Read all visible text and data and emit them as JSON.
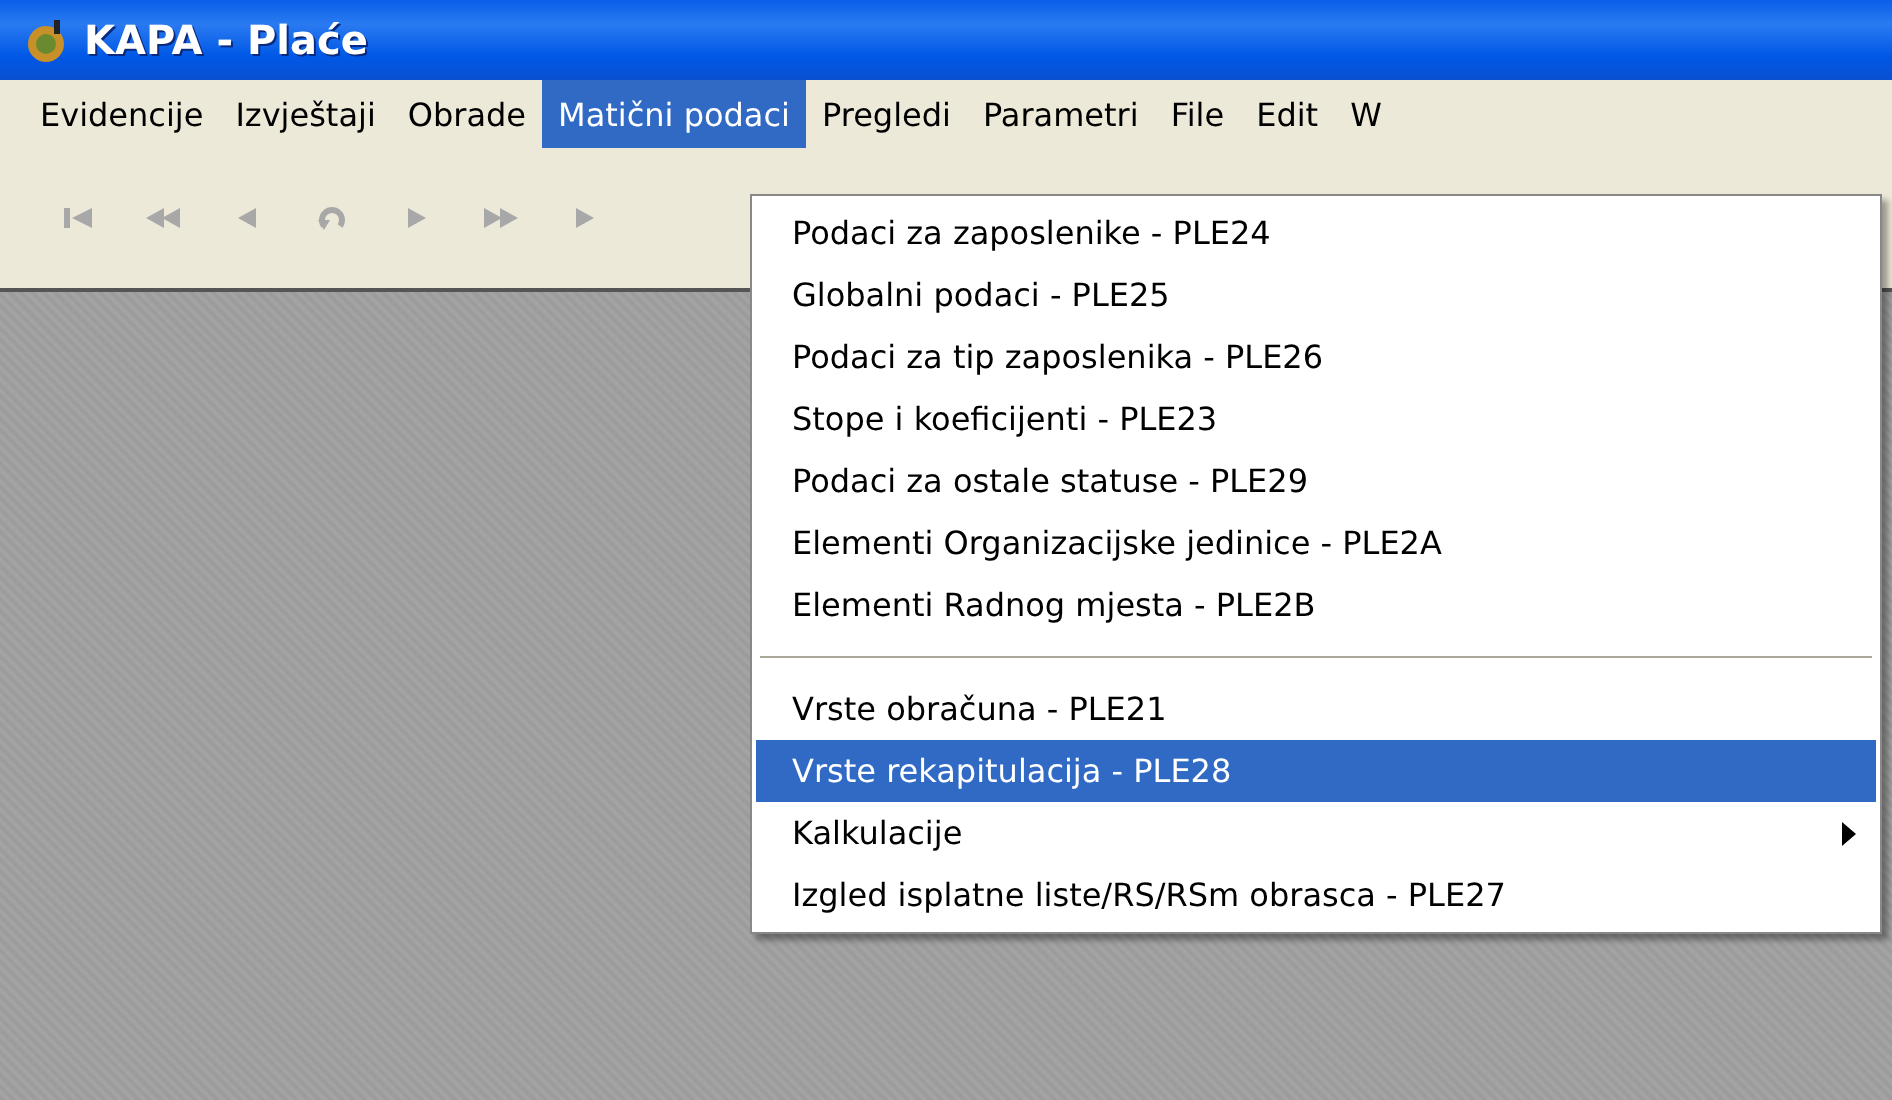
{
  "window": {
    "title": "KAPA - Plaće"
  },
  "menu_bar": [
    {
      "label": "Evidencije",
      "selected": false
    },
    {
      "label": "Izvještaji",
      "selected": false
    },
    {
      "label": "Obrade",
      "selected": false
    },
    {
      "label": "Matični podaci",
      "selected": true
    },
    {
      "label": "Pregledi",
      "selected": false
    },
    {
      "label": "Parametri",
      "selected": false
    },
    {
      "label": "File",
      "selected": false
    },
    {
      "label": "Edit",
      "selected": false
    },
    {
      "label": "W",
      "selected": false
    }
  ],
  "dropdown": [
    {
      "kind": "item",
      "label": "Podaci za zaposlenike - PLE24",
      "selected": false
    },
    {
      "kind": "item",
      "label": "Globalni podaci - PLE25",
      "selected": false
    },
    {
      "kind": "item",
      "label": "Podaci za tip zaposlenika - PLE26",
      "selected": false
    },
    {
      "kind": "item",
      "label": "Stope i koeficijenti - PLE23",
      "selected": false
    },
    {
      "kind": "item",
      "label": "Podaci za ostale statuse - PLE29",
      "selected": false
    },
    {
      "kind": "item",
      "label": "Elementi Organizacijske jedinice - PLE2A",
      "selected": false
    },
    {
      "kind": "item",
      "label": "Elementi Radnog mjesta - PLE2B",
      "selected": false
    },
    {
      "kind": "separator"
    },
    {
      "kind": "item",
      "label": "Vrste obračuna - PLE21",
      "selected": false
    },
    {
      "kind": "item",
      "label": "Vrste rekapitulacija - PLE28",
      "selected": true
    },
    {
      "kind": "submenu",
      "label": "Kalkulacije",
      "selected": false
    },
    {
      "kind": "item",
      "label": "Izgled isplatne liste/RS/RSm obrasca - PLE27",
      "selected": false
    }
  ]
}
